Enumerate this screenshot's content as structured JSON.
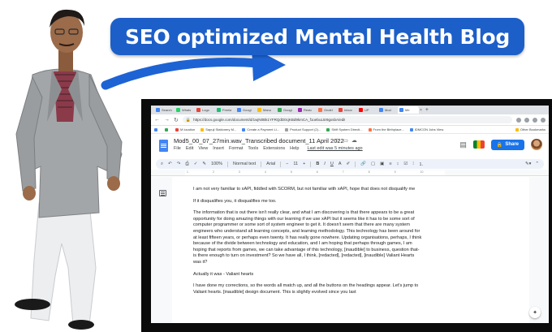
{
  "banner": {
    "headline": "SEO optimized Mental Health Blog"
  },
  "browser": {
    "tabs": [
      {
        "label": "Search",
        "color": "#4285f4"
      },
      {
        "label": "Whats",
        "color": "#25d366"
      },
      {
        "label": "Logo",
        "color": "#ea4335"
      },
      {
        "label": "Freela",
        "color": "#1dbf73"
      },
      {
        "label": "Googl",
        "color": "#4285f4"
      },
      {
        "label": "Manu",
        "color": "#fbbc04"
      },
      {
        "label": "Googl",
        "color": "#34a853"
      },
      {
        "label": "Resto",
        "color": "#9c27b0"
      },
      {
        "label": "Ondel",
        "color": "#ff7043"
      },
      {
        "label": "Inbox",
        "color": "#ea4335"
      },
      {
        "label": "UP",
        "color": "#ff0000"
      },
      {
        "label": "Mod",
        "color": "#4285f4"
      },
      {
        "label": "Me",
        "color": "#4285f4"
      }
    ],
    "active_tab_index": 12,
    "url": "https://docs.google.com/document/d/1wjN0Bk1YFRQdD0cjKBd9kmCA_f1oebuL5r9gxsbA/edit",
    "bookmarks": [
      {
        "label": "",
        "color": "#4285f4"
      },
      {
        "label": "",
        "color": "#34a853"
      },
      {
        "label": "M location",
        "color": "#ea4335"
      },
      {
        "label": "Sapuji Stationery M...",
        "color": "#fbbc04"
      },
      {
        "label": "Create a Payment Li...",
        "color": "#4285f4"
      },
      {
        "label": "Product Support (2)...",
        "color": "#9e9e9e"
      },
      {
        "label": "Shift System Directi...",
        "color": "#34a853"
      },
      {
        "label": "From the Birthplace...",
        "color": "#ff7043"
      },
      {
        "label": "IDMCON Jobs View",
        "color": "#4285f4"
      }
    ],
    "bookmarks_right": "Other Bookmarks"
  },
  "doc": {
    "title": "Mod5_00_07_27min.wav_Transcribed document_11 April 2022",
    "menus": [
      "File",
      "Edit",
      "View",
      "Insert",
      "Format",
      "Tools",
      "Extensions",
      "Help"
    ],
    "last_edit": "Last edit was 5 minutes ago",
    "share_label": "Share",
    "toolbar": {
      "zoom": "100%",
      "style": "Normal text",
      "font": "Arial",
      "size": "11"
    },
    "paragraphs": [
      "I am not very familiar to xAPI, fiddled with SCORM, but not familiar with xAPI, hope that does not disqualify me",
      "If it disqualifies you, it disqualifies me too.",
      "The information that is out there isn't really clear, and what I am discovering is that there appears to be a great opportunity for doing amazing things with our learning if we use xAPI but it seems like it has to be some sort of computer programmer or some sort of system engineer to get it. It doesn't seem that there are many system engineers who understand all learning concepts, and learning methodology. This technology has been around for at least fifteen years, or perhaps even twenty. It has really gone nowhere. Updating organisations, perhaps, I think because of the divide between technology and education, and I am hoping that perhaps through games, I am hoping that reports from games, we can take advantage of this technology, [inaudible] to business, question that- is there enough to turn on investment? So we have all, I think, [redacted], [redacted], [inaudible] Valiant Hearts was it?",
      "Actually it was - Valiant hearts",
      "I have done my corrections, so the words all match up, and all the buttons on the headings appear. Let's jump to Valiant hearts. [inaudible] design document. This is slightly evolved since you last"
    ]
  }
}
